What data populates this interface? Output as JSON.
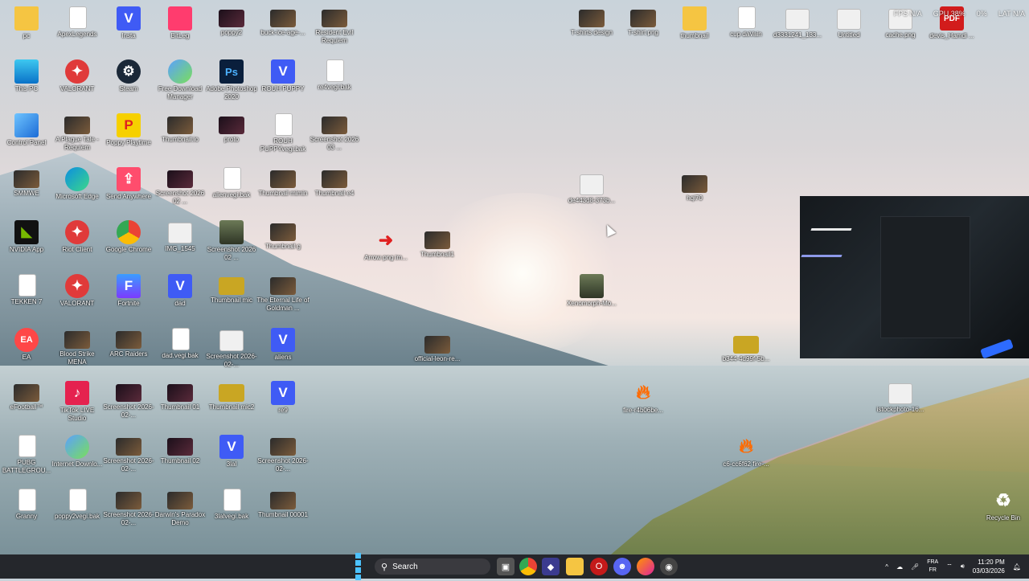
{
  "desktop": {
    "icons": [
      {
        "label": "pc",
        "kind": "folder"
      },
      {
        "label": "ApexLegends",
        "kind": "file"
      },
      {
        "label": "Insta",
        "kind": "v"
      },
      {
        "label": "BitLeg",
        "kind": "pink"
      },
      {
        "label": "poppy2",
        "kind": "dark"
      },
      {
        "label": "buck-ice-age-...",
        "kind": "thumb"
      },
      {
        "label": "Resident Evil Requiem",
        "kind": "thumb"
      },
      {
        "label": "This PC",
        "kind": "pc"
      },
      {
        "label": "VALORANT",
        "kind": "red"
      },
      {
        "label": "Steam",
        "kind": "steam"
      },
      {
        "label": "Free Download Manager",
        "kind": "dl"
      },
      {
        "label": "Adobe Photoshop 2020",
        "kind": "ps"
      },
      {
        "label": "ROUH PUPPY",
        "kind": "v"
      },
      {
        "label": "re4vegi.bak",
        "kind": "file"
      },
      {
        "label": "Control Panel",
        "kind": "cp"
      },
      {
        "label": "A Plague Tale - Requiem",
        "kind": "thumb"
      },
      {
        "label": "Poppy Playtime",
        "kind": "yellow"
      },
      {
        "label": "Thumbnail.io",
        "kind": "thumb"
      },
      {
        "label": "proto",
        "kind": "dark"
      },
      {
        "label": "ROUH PUPPYvegi.bak",
        "kind": "file"
      },
      {
        "label": "Screenshot 2026 03 ...",
        "kind": "thumb"
      },
      {
        "label": "SMMWE",
        "kind": "thumb"
      },
      {
        "label": "Microsoft Edge",
        "kind": "edge"
      },
      {
        "label": "Send Anywhere",
        "kind": "send"
      },
      {
        "label": "Screenshot 2026 02 ...",
        "kind": "dark"
      },
      {
        "label": "alienvegi.bak",
        "kind": "file"
      },
      {
        "label": "Thumbnail mimin",
        "kind": "thumb"
      },
      {
        "label": "Thumbnail e4",
        "kind": "thumb"
      },
      {
        "label": "NVIDIA App",
        "kind": "nvidia"
      },
      {
        "label": "Riot Client",
        "kind": "red"
      },
      {
        "label": "Google Chrome",
        "kind": "chrome"
      },
      {
        "label": "IMG_1545",
        "kind": "img"
      },
      {
        "label": "Screenshot 2026 02 ...",
        "kind": "alien"
      },
      {
        "label": "Thumbnail g",
        "kind": "thumb"
      },
      {
        "label": "Arrow png im...",
        "kind": "arrow"
      },
      {
        "label": "Thumbnail1",
        "kind": "thumb"
      },
      {
        "label": "TEKKEN 7",
        "kind": "file"
      },
      {
        "label": "VALORANT",
        "kind": "red"
      },
      {
        "label": "Fortnite",
        "kind": "fortnite"
      },
      {
        "label": "dad",
        "kind": "v"
      },
      {
        "label": "Thumbnail mic",
        "kind": "gold"
      },
      {
        "label": "The Eternal Life of Goldman ...",
        "kind": "thumb"
      },
      {
        "label": "EA",
        "kind": "ea"
      },
      {
        "label": "Blood Strike MENA",
        "kind": "thumb"
      },
      {
        "label": "ARC Raiders",
        "kind": "thumb"
      },
      {
        "label": "dad.vegi.bak",
        "kind": "file"
      },
      {
        "label": "Screenshot 2026-02-...",
        "kind": "img"
      },
      {
        "label": "aliens",
        "kind": "v"
      },
      {
        "label": "official-leon-re...",
        "kind": "thumb"
      },
      {
        "label": "eFootball™",
        "kind": "thumb"
      },
      {
        "label": "TikTok LIVE Studio",
        "kind": "tiktok"
      },
      {
        "label": "Screenshot 2026-02-...",
        "kind": "dark"
      },
      {
        "label": "Thumbnail 01",
        "kind": "dark"
      },
      {
        "label": "Thumbnail mic2",
        "kind": "gold"
      },
      {
        "label": "re9",
        "kind": "v"
      },
      {
        "label": "PUBG BATTLEGROU...",
        "kind": "file"
      },
      {
        "label": "Internet Downlo...",
        "kind": "dl"
      },
      {
        "label": "Screenshot 2026-02-...",
        "kind": "thumb"
      },
      {
        "label": "Thumbnail 02",
        "kind": "dark"
      },
      {
        "label": "3lal",
        "kind": "v"
      },
      {
        "label": "Screenshot 2026-02-...",
        "kind": "thumb"
      },
      {
        "label": "Granny",
        "kind": "file"
      },
      {
        "label": "poppy2vegi.bak",
        "kind": "file"
      },
      {
        "label": "Screenshot 2026-02-...",
        "kind": "thumb"
      },
      {
        "label": "Darwin's Paradox Demo",
        "kind": "thumb"
      },
      {
        "label": "3lalvegi.bak",
        "kind": "file"
      },
      {
        "label": "Thumbnail 00001",
        "kind": "thumb"
      },
      {
        "label": "T-shirts design",
        "kind": "thumb"
      },
      {
        "label": "T-shirt png",
        "kind": "thumb"
      },
      {
        "label": "thumbnail",
        "kind": "folder"
      },
      {
        "label": "cup daVain",
        "kind": "file"
      },
      {
        "label": "d3331241_133...",
        "kind": "img"
      },
      {
        "label": "Untitled",
        "kind": "img"
      },
      {
        "label": "cache.png",
        "kind": "img"
      },
      {
        "label": "devis_Hamdi ...",
        "kind": "pdf"
      },
      {
        "label": "de443d8-373b...",
        "kind": "img"
      },
      {
        "label": "hqi70",
        "kind": "thumb"
      },
      {
        "label": "Xenomorph-Mo...",
        "kind": "alien"
      },
      {
        "label": "b344-4d99f-5b...",
        "kind": "gold"
      },
      {
        "label": "fire-r4b06be...",
        "kind": "fire"
      },
      {
        "label": "istockphoto-16...",
        "kind": "img"
      },
      {
        "label": "c6-cc6f62 fire-...",
        "kind": "fire"
      },
      {
        "label": "Recycle Bin",
        "kind": "recycle"
      }
    ]
  },
  "overlay": {
    "fps": "FPS N/A",
    "gpu": "GPU 38%",
    "cpu": "0%",
    "lat": "LAT N/A"
  },
  "taskbar": {
    "search_placeholder": "Search",
    "lang_top": "FRA",
    "lang_bottom": "FR",
    "time": "11:20 PM",
    "date": "03/03/2026"
  }
}
